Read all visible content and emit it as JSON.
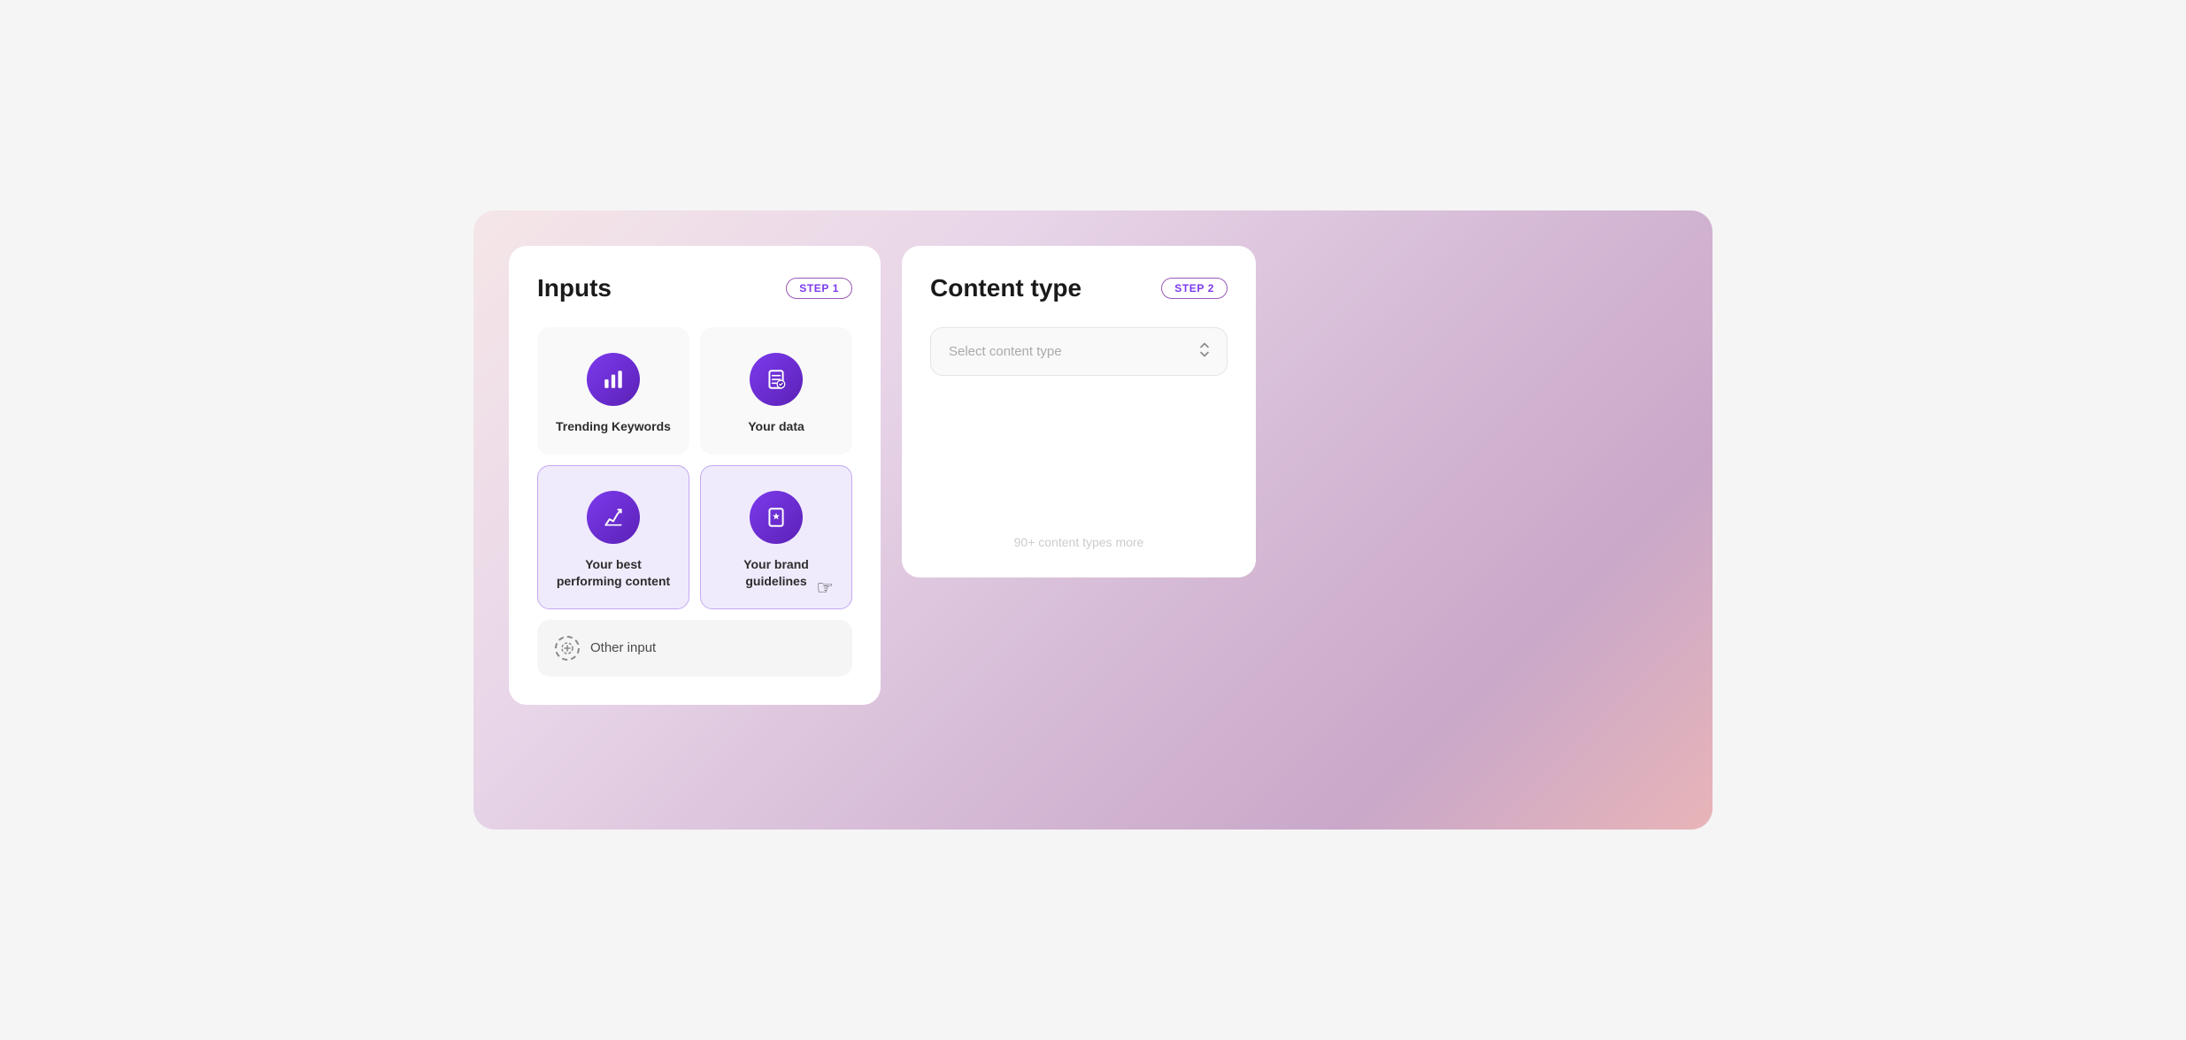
{
  "inputs_panel": {
    "title": "Inputs",
    "step_label": "STEP 1",
    "cards": [
      {
        "id": "trending-keywords",
        "label": "Trending Keywords",
        "icon": "📊",
        "active": false
      },
      {
        "id": "your-data",
        "label": "Your data",
        "icon": "📋",
        "active": false
      },
      {
        "id": "best-performing",
        "label": "Your best performing content",
        "icon": "✏️",
        "active": false
      },
      {
        "id": "brand-guidelines",
        "label": "Your brand guidelines",
        "icon": "⭐",
        "active": true
      }
    ],
    "other_input_label": "Other input"
  },
  "content_type_panel": {
    "title": "Content type",
    "step_label": "STEP 2",
    "select_placeholder": "Select content type",
    "more_text": "90+ content types more"
  },
  "icons": {
    "trending_keywords": "bar-chart-icon",
    "your_data": "data-icon",
    "best_performing": "edit-icon",
    "brand_guidelines": "star-doc-icon",
    "add_other": "add-circle-icon",
    "chevron": "chevron-updown-icon"
  }
}
